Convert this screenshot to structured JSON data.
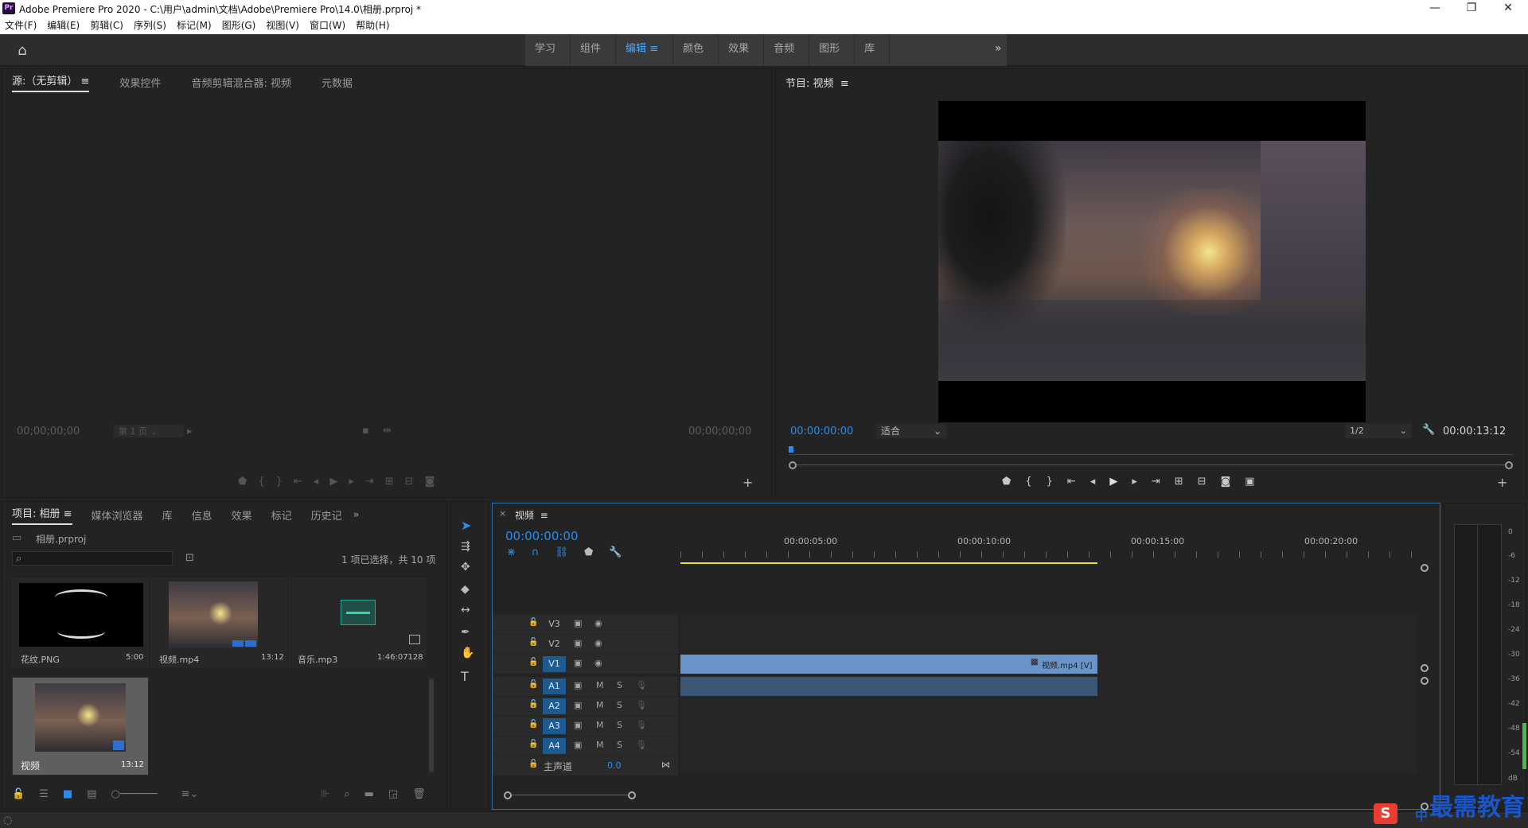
{
  "app": {
    "icon_label": "Pr",
    "title": "Adobe Premiere Pro 2020 - C:\\用户\\admin\\文档\\Adobe\\Premiere Pro\\14.0\\相册.prproj *"
  },
  "window_controls": {
    "minimize": "—",
    "maximize": "❐",
    "close": "✕"
  },
  "menu": [
    "文件(F)",
    "编辑(E)",
    "剪辑(C)",
    "序列(S)",
    "标记(M)",
    "图形(G)",
    "视图(V)",
    "窗口(W)",
    "帮助(H)"
  ],
  "workspaces": {
    "tabs": [
      "学习",
      "组件",
      "编辑",
      "颜色",
      "效果",
      "音频",
      "图形",
      "库"
    ],
    "active": "编辑",
    "more": "»"
  },
  "source_panel": {
    "tabs": [
      "源:（无剪辑）",
      "效果控件",
      "音频剪辑混合器: 视频",
      "元数据"
    ],
    "tc_left": "00;00;00;00",
    "tc_right": "00;00;00;00",
    "page_select": "第 1 页"
  },
  "program_panel": {
    "tab": "节目: 视频",
    "timecode": "00:00:00:00",
    "fit": "适合",
    "resolution": "1/2",
    "duration": "00:00:13:12"
  },
  "project_panel": {
    "tabs": [
      "项目: 相册",
      "媒体浏览器",
      "库",
      "信息",
      "效果",
      "标记",
      "历史记"
    ],
    "file": "相册.prproj",
    "selection_info": "1 项已选择，共 10 项",
    "items": [
      {
        "name": "花纹.PNG",
        "duration": "5:00"
      },
      {
        "name": "视频.mp4",
        "duration": "13:12"
      },
      {
        "name": "音乐.mp3",
        "duration": "1:46:07128"
      },
      {
        "name": "视频",
        "duration": "13:12"
      }
    ]
  },
  "timeline": {
    "tab": "视频",
    "timecode": "00:00:00:00",
    "ruler": [
      "00:00:05:00",
      "00:00:10:00",
      "00:00:15:00",
      "00:00:20:00"
    ],
    "video_tracks": [
      "V3",
      "V2",
      "V1"
    ],
    "audio_tracks": [
      "A1",
      "A2",
      "A3",
      "A4"
    ],
    "master": {
      "label": "主声道",
      "value": "0.0"
    },
    "clip_label": "视频.mp4 [V]",
    "mute": "M",
    "solo": "S"
  },
  "meter": {
    "scale": [
      "0",
      "-6",
      "-12",
      "-18",
      "-24",
      "-30",
      "-36",
      "-42",
      "-48",
      "-54",
      "dB"
    ]
  },
  "watermark": {
    "text": "最需教育",
    "ime": "中"
  },
  "colors": {
    "accent": "#2d8ceb",
    "clip_video": "#6a93c7",
    "clip_audio": "#3b5677",
    "in_out": "#e8e03a"
  }
}
